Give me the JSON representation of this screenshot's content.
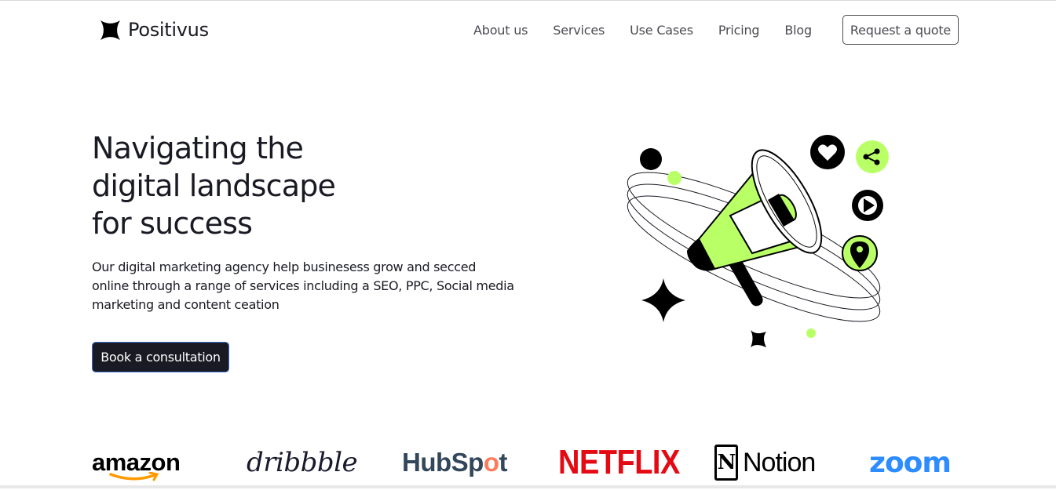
{
  "brand": {
    "name": "Positivus",
    "logo_icon": "star-burst-icon"
  },
  "nav": {
    "items": [
      {
        "label": "About us"
      },
      {
        "label": "Services"
      },
      {
        "label": "Use Cases"
      },
      {
        "label": "Pricing"
      },
      {
        "label": "Blog"
      }
    ],
    "cta_label": "Request a quote"
  },
  "hero": {
    "title_lines": [
      "Navigating the",
      "digital landscape",
      "for success"
    ],
    "description": "Our digital marketing agency help businesess grow and secced online through a range of services including a SEO, PPC, Social media marketing and content ceation",
    "cta_label": "Book a consultation",
    "illustration_icons": [
      "megaphone-icon",
      "heart-icon",
      "share-icon",
      "play-icon",
      "location-pin-icon",
      "sparkle-icon"
    ]
  },
  "clients": {
    "logos": [
      {
        "name": "amazon",
        "text": "amazon"
      },
      {
        "name": "dribbble",
        "text": "dribbble"
      },
      {
        "name": "hubspot",
        "text_a": "HubSp",
        "text_b": "o",
        "text_c": "t"
      },
      {
        "name": "netflix",
        "text": "NETFLIX"
      },
      {
        "name": "notion",
        "mark": "N",
        "text": "Notion"
      },
      {
        "name": "zoom",
        "text": "zoom"
      }
    ]
  },
  "colors": {
    "accent": "#B9FF66",
    "dark": "#191A23",
    "text_gray": "#4B4B52"
  }
}
